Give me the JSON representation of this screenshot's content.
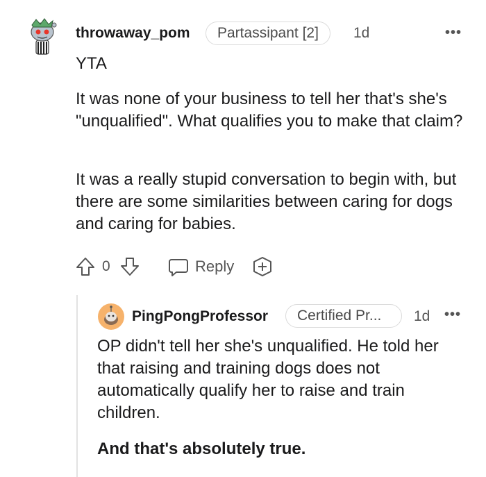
{
  "comment": {
    "username": "throwaway_pom",
    "flair": "Partassipant [2]",
    "time": "1d",
    "more": "•••",
    "paragraphs": [
      "YTA",
      "It was none of your business to tell her that's she's \"unqualified\". What qualifies you to make that claim?",
      "It was a really stupid conversation to begin with, but there are some similarities between caring for dogs and caring for babies."
    ],
    "score": "0",
    "reply_label": "Reply"
  },
  "reply": {
    "username": "PingPongProfessor",
    "flair": "Certified Pr...",
    "time": "1d",
    "more": "•••",
    "paragraphs": [
      "OP didn't tell her she's unqualified. He told her that raising and training dogs does not automatically qualify her to raise and train children.",
      "And that's absolutely true."
    ]
  },
  "icons": {
    "upvote": "upvote-arrow-icon",
    "downvote": "downvote-arrow-icon",
    "reply": "speech-bubble-icon",
    "award": "award-plus-icon"
  }
}
